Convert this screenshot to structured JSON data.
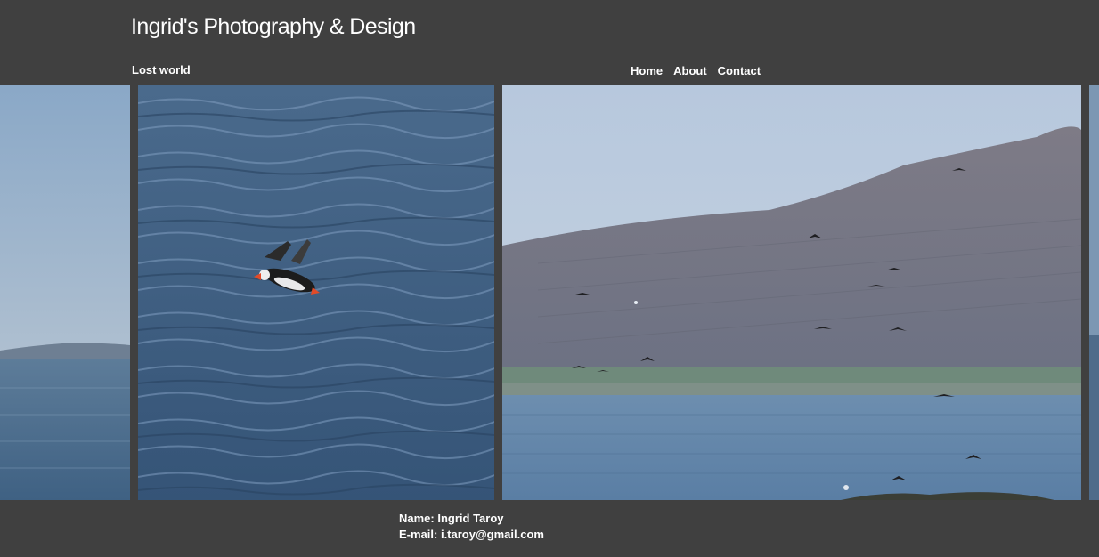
{
  "header": {
    "site_title": "Ingrid's Photography & Design",
    "gallery_title": "Lost world"
  },
  "nav": {
    "items": [
      {
        "label": "Home"
      },
      {
        "label": "About"
      },
      {
        "label": "Contact"
      }
    ]
  },
  "gallery": {
    "photos": [
      {
        "icon": "partial-seascape-photo"
      },
      {
        "icon": "puffin-over-water-photo"
      },
      {
        "icon": "birds-mountain-fjord-photo"
      },
      {
        "icon": "partial-next-photo"
      }
    ]
  },
  "footer": {
    "name_line": "Name: Ingrid Taroy",
    "email_line": "E-mail: i.taroy@gmail.com"
  },
  "colors": {
    "background": "#404040",
    "text": "#ffffff"
  }
}
